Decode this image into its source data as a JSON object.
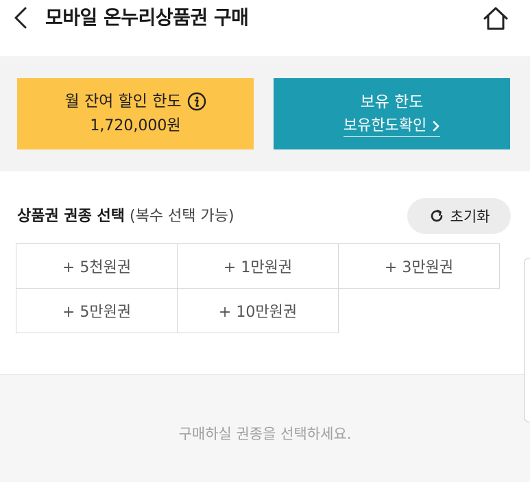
{
  "header": {
    "title": "모바일 온누리상품권 구매",
    "back_icon": "chevron-left-icon",
    "home_icon": "home-icon"
  },
  "banner": {
    "limit_card": {
      "label": "월 잔여 할인 한도",
      "amount": "1,720,000원",
      "color": "#fdc44a",
      "icon": "info-icon"
    },
    "hold_card": {
      "label": "보유 한도",
      "link_label": "보유한도확인",
      "color": "#1d9bb0",
      "icon": "chevron-right-icon"
    }
  },
  "voucher_section": {
    "title": "상품권 권종 선택",
    "subtitle": "(복수 선택 가능)",
    "reset_label": "초기화",
    "reset_icon": "refresh-icon",
    "options": [
      "+ 5천원권",
      "+ 1만원권",
      "+ 3만원권",
      "+ 5만원권",
      "+ 10만원권"
    ]
  },
  "empty_state": {
    "message": "구매하실 권종을 선택하세요."
  }
}
